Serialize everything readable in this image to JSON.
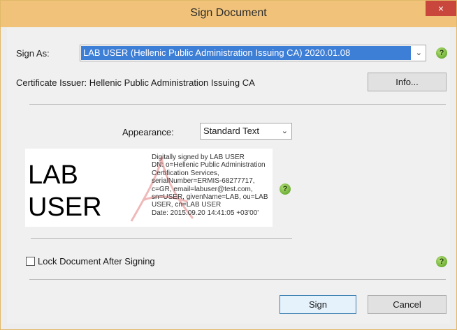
{
  "window": {
    "title": "Sign Document",
    "close_glyph": "×"
  },
  "sign_as": {
    "label": "Sign As:",
    "selected": "LAB USER (Hellenic Public Administration Issuing CA) 2020.01.08"
  },
  "certificate_issuer": {
    "text": "Certificate Issuer: Hellenic Public Administration Issuing CA"
  },
  "info_button": {
    "label": "Info..."
  },
  "appearance": {
    "label": "Appearance:",
    "selected": "Standard Text"
  },
  "signature_preview": {
    "name_line1": "LAB",
    "name_line2": "USER",
    "details": [
      "Digitally signed by LAB USER",
      "DN: o=Hellenic Public Administration",
      "Certification Services,",
      "serialNumber=ERMIS-68277717,",
      "c=GR, email=labuser@test.com,",
      "sn=USER, givenName=LAB, ou=LAB",
      "USER, cn=LAB USER",
      "Date: 2015.09.20 14:41:05 +03'00'"
    ]
  },
  "lock_document": {
    "label": "Lock Document After Signing",
    "checked": false
  },
  "buttons": {
    "sign": "Sign",
    "cancel": "Cancel"
  },
  "help_icon": {
    "glyph": "?"
  },
  "colors": {
    "titlebar": "#f1c37a",
    "close": "#c9463c",
    "selection": "#3d7ed6",
    "help": "#6fb22a"
  }
}
